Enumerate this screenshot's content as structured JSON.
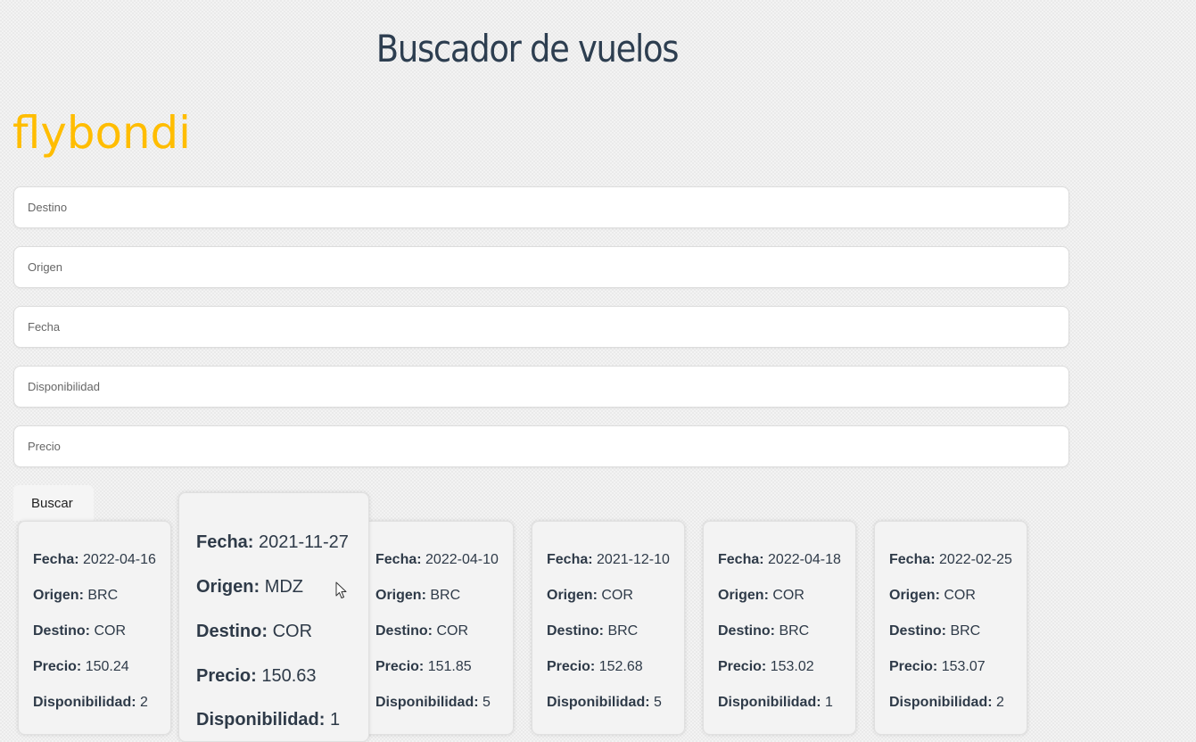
{
  "header": {
    "title": "Buscador de vuelos"
  },
  "logo": {
    "text": "flybondi",
    "color": "#ffbd00"
  },
  "form": {
    "destino_placeholder": "Destino",
    "origen_placeholder": "Origen",
    "fecha_placeholder": "Fecha",
    "disponibilidad_placeholder": "Disponibilidad",
    "precio_placeholder": "Precio",
    "search_label": "Buscar"
  },
  "labels": {
    "fecha": "Fecha:",
    "origen": "Origen:",
    "destino": "Destino:",
    "precio": "Precio:",
    "disponibilidad": "Disponibilidad:"
  },
  "flights": [
    {
      "fecha": "2022-04-16",
      "origen": "BRC",
      "destino": "COR",
      "precio": "150.24",
      "disponibilidad": "2"
    },
    {
      "fecha": "2021-11-27",
      "origen": "MDZ",
      "destino": "COR",
      "precio": "150.63",
      "disponibilidad": "1"
    },
    {
      "fecha": "2022-04-10",
      "origen": "BRC",
      "destino": "COR",
      "precio": "151.85",
      "disponibilidad": "5"
    },
    {
      "fecha": "2021-12-10",
      "origen": "COR",
      "destino": "BRC",
      "precio": "152.68",
      "disponibilidad": "5"
    },
    {
      "fecha": "2022-04-18",
      "origen": "COR",
      "destino": "BRC",
      "precio": "153.02",
      "disponibilidad": "1"
    },
    {
      "fecha": "2022-02-25",
      "origen": "COR",
      "destino": "BRC",
      "precio": "153.07",
      "disponibilidad": "2"
    }
  ],
  "colors": {
    "title": "#2d3e50",
    "text": "#2e3a48",
    "accent": "#ffbd00"
  }
}
